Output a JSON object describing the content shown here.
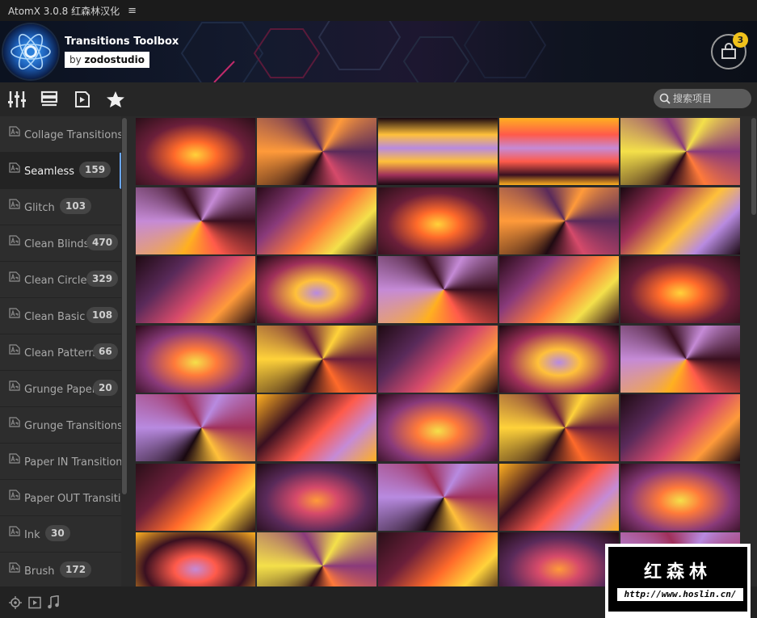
{
  "app": {
    "title": "AtomX 3.0.8 红森林汉化",
    "menu_glyph": "≡"
  },
  "product": {
    "title": "Transitions Toolbox",
    "by_prefix": "by ",
    "author": "zodostudio"
  },
  "cart": {
    "count": "3"
  },
  "search": {
    "placeholder": "搜索项目"
  },
  "sidebar": {
    "items": [
      {
        "label": "Collage Transitions",
        "count": ""
      },
      {
        "label": "Seamless",
        "count": "159"
      },
      {
        "label": "Glitch",
        "count": "103"
      },
      {
        "label": "Clean Blinds",
        "count": "470"
      },
      {
        "label": "Clean Circle",
        "count": "329"
      },
      {
        "label": "Clean Basic",
        "count": "108"
      },
      {
        "label": "Clean Patterns",
        "count": "66"
      },
      {
        "label": "Grunge Paper",
        "count": "20"
      },
      {
        "label": "Grunge Transitions",
        "count": ""
      },
      {
        "label": "Paper IN Transition",
        "count": ""
      },
      {
        "label": "Paper OUT Transitio",
        "count": ""
      },
      {
        "label": "Ink",
        "count": "30"
      },
      {
        "label": "Brush",
        "count": "172"
      }
    ],
    "active_index": 1
  },
  "watermark": {
    "title": "红森林",
    "url": "http://www.hoslin.cn/"
  },
  "theme": {
    "accent": "#6aa7ff",
    "badge": "#f1c21b"
  }
}
